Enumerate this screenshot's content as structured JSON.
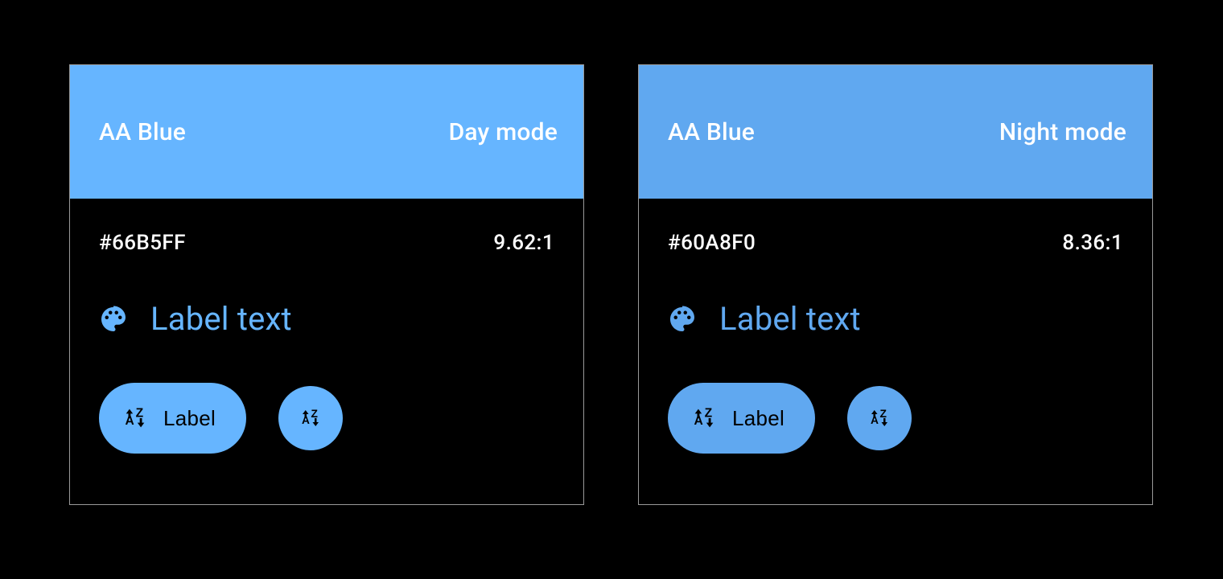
{
  "cards": [
    {
      "title": "AA Blue",
      "mode": "Day mode",
      "hex": "#66B5FF",
      "ratio": "9.62:1",
      "label_text": "Label text",
      "pill_label": "Label",
      "color": "#66B5FF"
    },
    {
      "title": "AA Blue",
      "mode": "Night mode",
      "hex": "#60A8F0",
      "ratio": "8.36:1",
      "label_text": "Label text",
      "pill_label": "Label",
      "color": "#60A8F0"
    }
  ]
}
